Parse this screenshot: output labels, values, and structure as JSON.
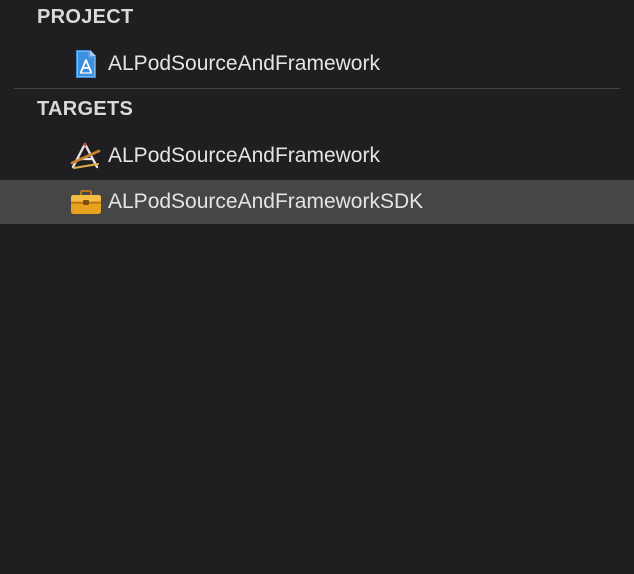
{
  "sections": {
    "project": {
      "header": "PROJECT",
      "items": [
        {
          "label": "ALPodSourceAndFramework",
          "icon": "xcodeproj-icon"
        }
      ]
    },
    "targets": {
      "header": "TARGETS",
      "items": [
        {
          "label": "ALPodSourceAndFramework",
          "icon": "app-target-icon"
        },
        {
          "label": "ALPodSourceAndFrameworkSDK",
          "icon": "framework-toolbox-icon",
          "selected": true
        }
      ]
    }
  },
  "colors": {
    "background": "#1f1f21",
    "selection": "#464646",
    "text": "#e4e4e4",
    "header_text": "#d9d9d9",
    "project_icon_blue": "#3b8fe0",
    "toolbox_orange": "#e9a21f"
  }
}
